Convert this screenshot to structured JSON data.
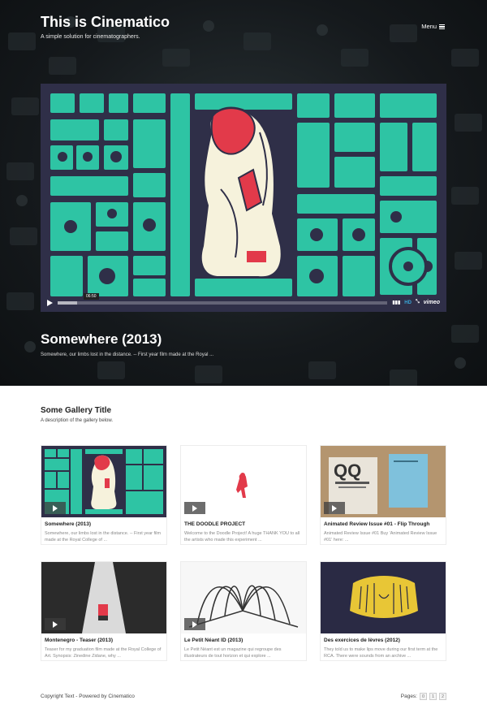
{
  "header": {
    "site_title": "This is Cinematico",
    "site_subtitle": "A simple solution for cinematographers.",
    "menu_label": "Menu"
  },
  "featured": {
    "title": "Somewhere (2013)",
    "description": "Somewhere, our limbs lost in the distance. -- First year film made at the Royal ...",
    "player": {
      "timecode": "06:50",
      "hd_label": "HD",
      "vimeo_label": "vimeo",
      "progress": 0.06
    }
  },
  "gallery": {
    "title": "Some Gallery Title",
    "description": "A description of the gallery below.",
    "items": [
      {
        "title": "Somewhere (2013)",
        "description": "Somewhere, our limbs lost in the distance. -- First year film made at the Royal College of ..."
      },
      {
        "title": "THE DOODLE PROJECT",
        "description": "Welcome to the Doodle Project! A huge THANK YOU to all the artists who made this experiment ..."
      },
      {
        "title": "Animated Review Issue #01 - Flip Through",
        "description": "Animated Review Issue #01 Buy 'Animated Review Issue #01' here: ..."
      },
      {
        "title": "Montenegro - Teaser (2013)",
        "description": "Teaser for my graduation film made at the Royal College of Art. Synopsis: Zinedine Zidane, why ..."
      },
      {
        "title": "Le Petit Néant ID (2013)",
        "description": "Le Petit Néant est un magazine qui regroupe des illustrateurs de tout horizon et qui explore ..."
      },
      {
        "title": "Des exercices de lèvres (2012)",
        "description": "They told us to make lips move during our first term at the RCA. There were sounds from an archive ..."
      }
    ]
  },
  "footer": {
    "copyright": "Copyright Text - Powered by Cinematico",
    "pages_label": "Pages:",
    "pages": [
      "0",
      "1",
      "2"
    ]
  },
  "colors": {
    "teal": "#2ec4a4",
    "navy": "#2f2f48",
    "red": "#e23a4a",
    "hero_dark": "#14181d"
  }
}
